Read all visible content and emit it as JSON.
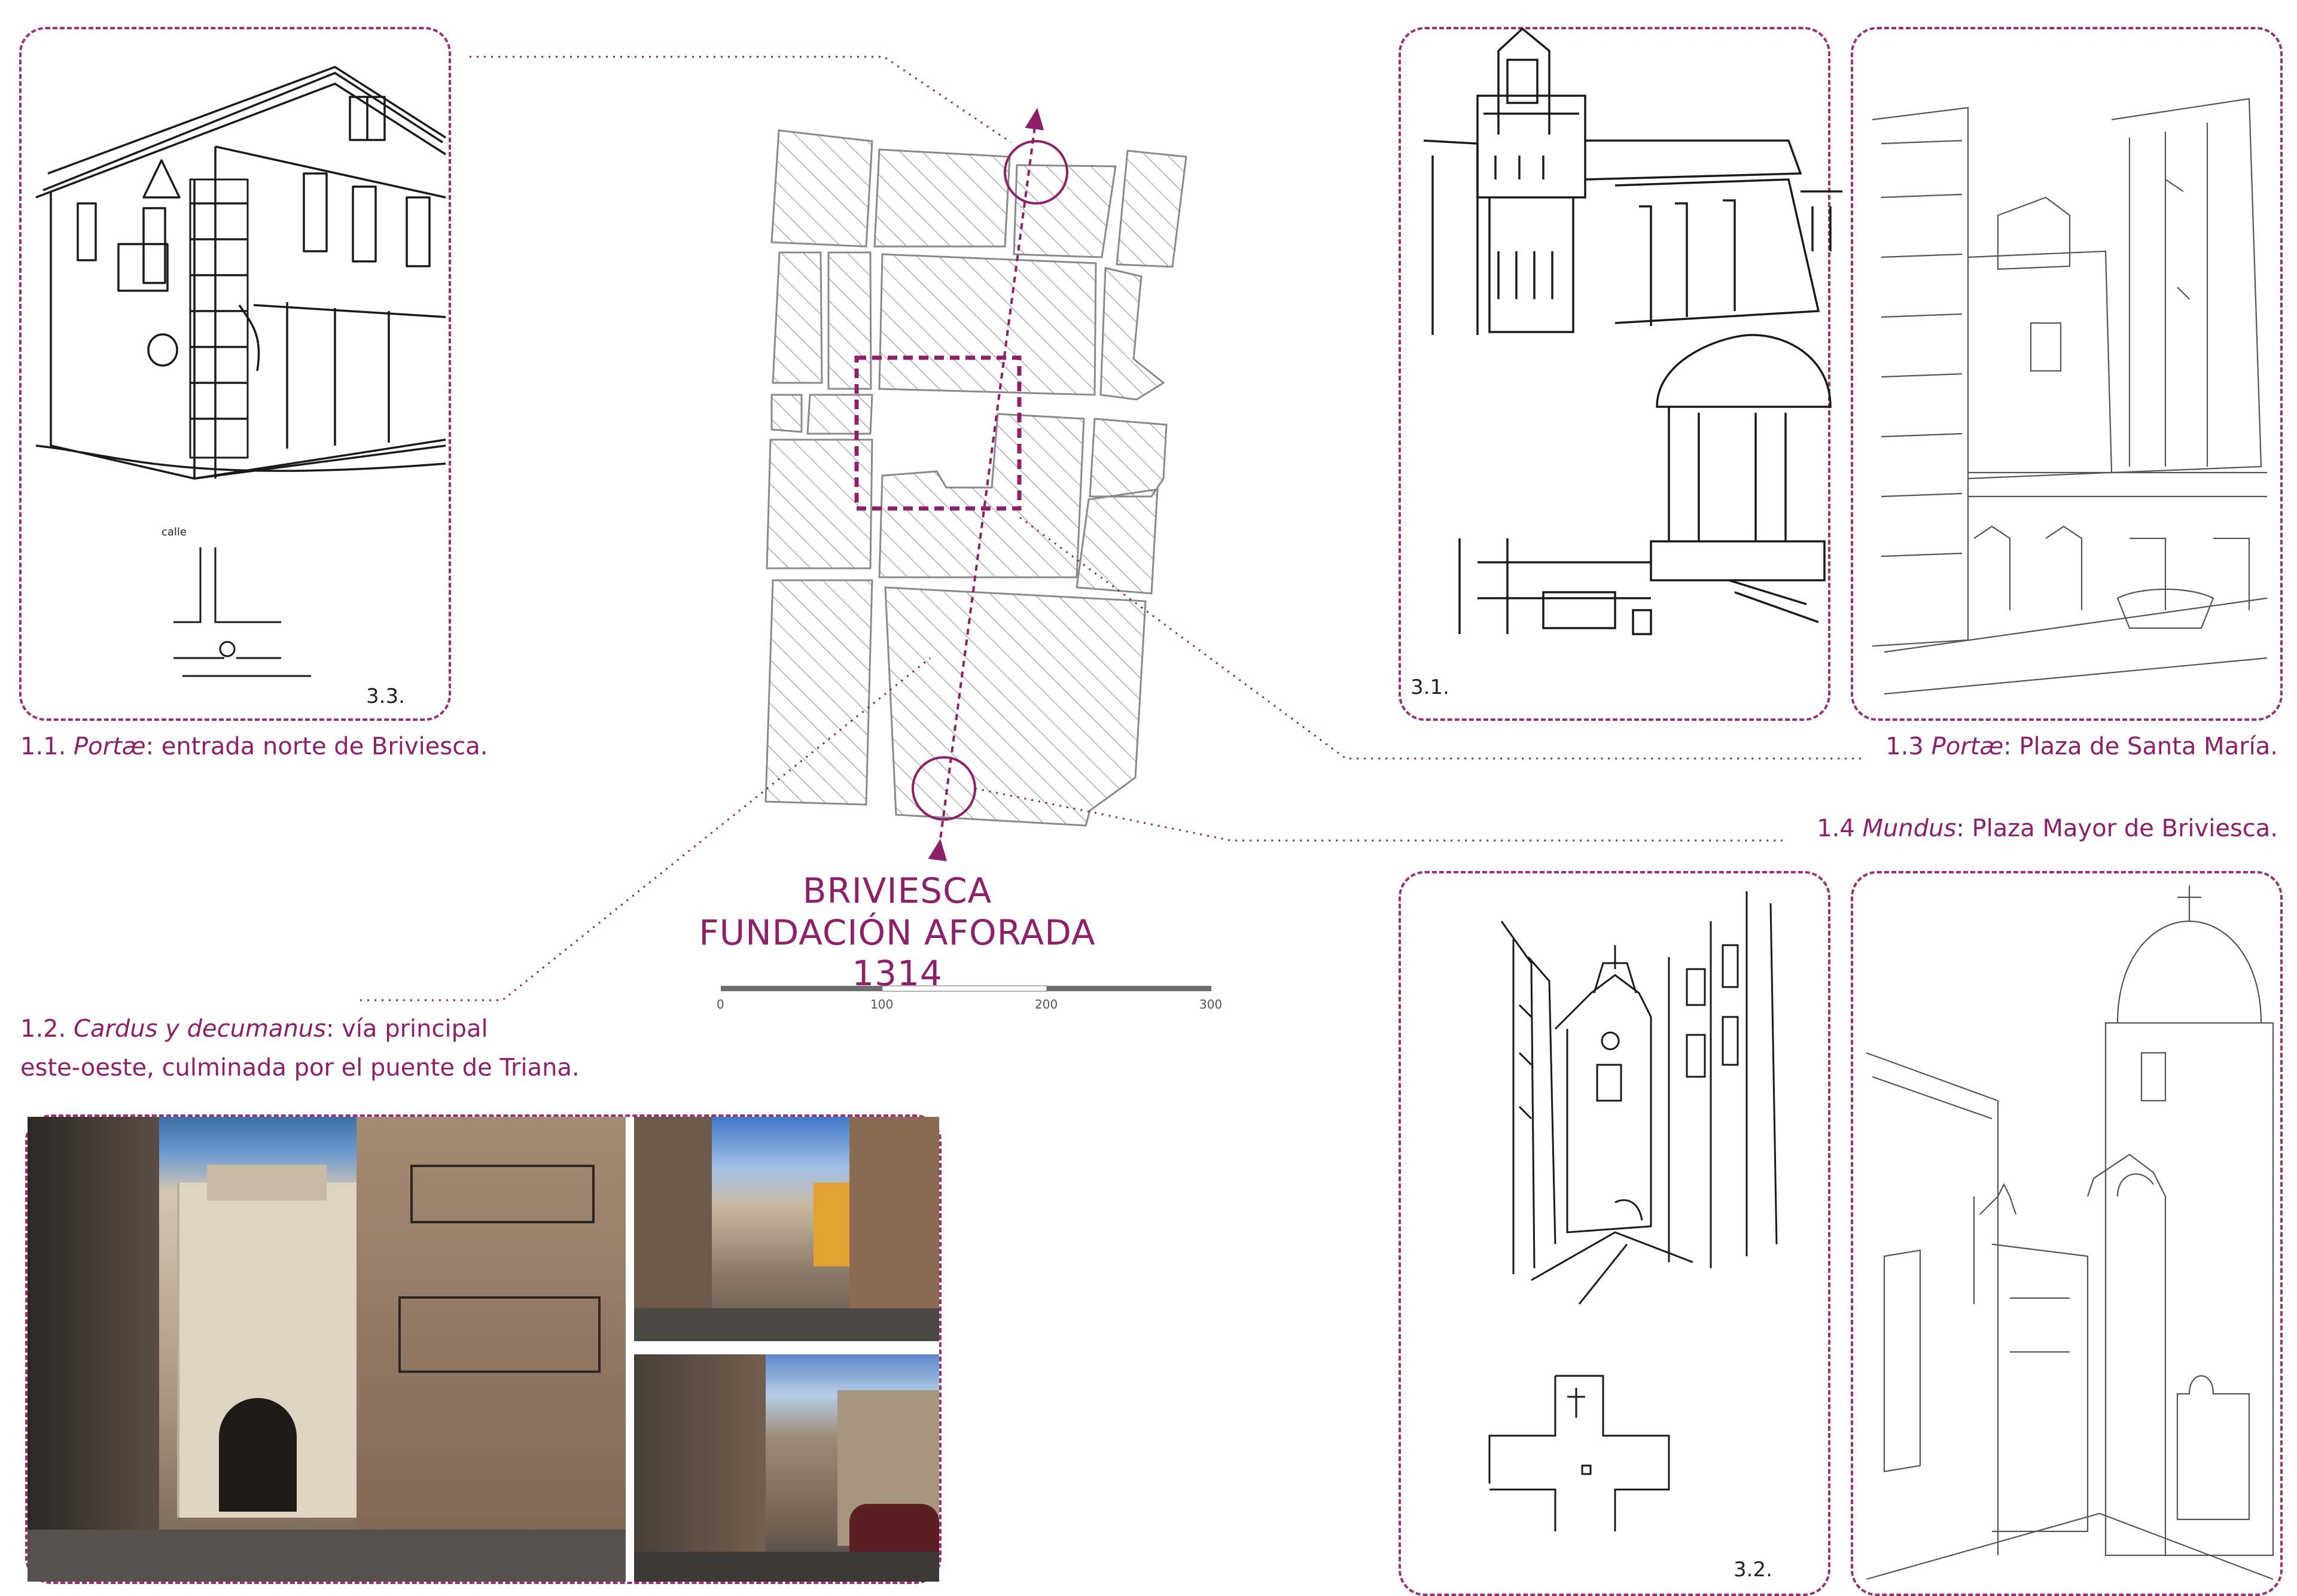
{
  "captions": {
    "c11_num": "1.1.",
    "c11_em": "Portæ",
    "c11_rest": ": entrada norte de Briviesca.",
    "c12_num": "1.2.",
    "c12_em": "Cardus y decumanus",
    "c12_rest": ": vía principal",
    "c12_line2": "este-oeste, culminada por el puente de Triana.",
    "c13_num": "1.3",
    "c13_em": "Portæ",
    "c13_rest": ": Plaza de Santa María.",
    "c14_num": "1.4",
    "c14_em": "Mundus",
    "c14_rest": ": Plaza Mayor de Briviesca."
  },
  "title": {
    "line1": "BRIVIESCA",
    "line2": "FUNDACIÓN AFORADA 1314"
  },
  "scale": [
    "0",
    "100",
    "200",
    "300"
  ],
  "sketch_notes": {
    "n11": "3.3.",
    "n13": "3.1.",
    "n14": "3.2."
  },
  "colors": {
    "accent": "#8e1f6b",
    "hatch": "#9a9a9a"
  }
}
